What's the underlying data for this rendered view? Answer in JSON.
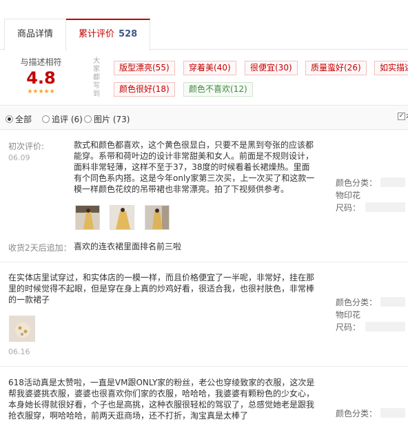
{
  "tabs": {
    "details": "商品详情",
    "reviews": "累计评价",
    "review_count": "528"
  },
  "rating": {
    "label": "与描述相符",
    "score": "4.8",
    "stars": "★★★★★",
    "vertical_label": "大家都写到",
    "tags_positive": [
      "版型漂亮(55)",
      "穿着美(40)",
      "很便宜(30)",
      "质量蛮好(26)",
      "如实描述",
      "颜色很好(18)"
    ],
    "tags_neutral": [
      "颜色不喜欢(12)"
    ]
  },
  "filter": {
    "all": "全部",
    "append": "追评 (6)",
    "pictures": "图片 (73)",
    "cut_text": "有"
  },
  "reviews": [
    {
      "first_label": "初次评价:",
      "date": "06.09",
      "lines": [
        "款式和颜色都喜欢，这个黄色很显白，只要不是黑到夸张的应该都",
        "能穿。系带和荷叶边的设计非常甜美和女人。前面是不规则设计，",
        "面料非常轻薄，这样不至于37，38度的时候看着长裙燥热。里面",
        "有个同色系内搭。这是今年only家第三次买，上一次买了和这款一",
        "模一样颜色花纹的吊带裙也非常漂亮。拍了下视频供参考。"
      ],
      "append_label": "收货2天后追加：",
      "append_text": "喜欢的连衣裙里面排名前三啦",
      "sku_color_label": "颜色分类：",
      "sku_color_value": "物印花",
      "sku_size_label": "尺码："
    },
    {
      "lines": [
        "在实体店里试穿过，和实体店的一模一样，而且价格便宜了一半呢，非常好，挂在那",
        "里的时候觉得不起眼，但是穿在身上真的炒鸡好看，很适合我，也很衬肤色，非常棒",
        "的一款裙子"
      ],
      "date": "06.16",
      "sku_color_label": "颜色分类：",
      "sku_color_value": "物印花",
      "sku_size_label": "尺码："
    },
    {
      "lines": [
        "618活动真是太赞啦，一直是VM跟ONLY家的粉丝，老公也穿绫致家的衣服，这次是",
        "帮我婆婆挑衣服，婆婆也很喜欢你们家的衣服，哈哈哈，我婆婆有颗粉色的少女心，",
        "本身她长得就很好看，个子也是高挑，这种衣服很轻松的驾驭了，总感觉她老是跟我",
        "抢衣服穿，啊哈哈哈，前两天逛商场，还不打折，淘宝真是太棒了"
      ],
      "sku_color_label": "颜色分类："
    }
  ],
  "colors": {
    "accent": "#c40000",
    "link_blue": "#3c5a8c",
    "star": "#f5a623",
    "neutral_tag": "#3e8a3e"
  }
}
